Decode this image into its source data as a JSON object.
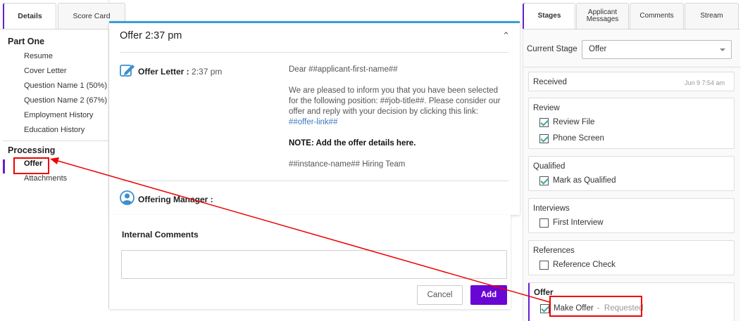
{
  "left_nav": {
    "tabs": [
      "Details",
      "Score Card"
    ],
    "sections": [
      {
        "title": "Part One",
        "items": [
          "Resume",
          "Cover Letter",
          "Question Name 1 (50%)",
          "Question Name 2 (67%)",
          "Employment History",
          "Education History"
        ]
      },
      {
        "title": "Processing",
        "items": [
          "Offer",
          "Attachments"
        ]
      }
    ],
    "active_item": "Offer"
  },
  "offer_card": {
    "title": "Offer 2:37 pm",
    "letter_label": "Offer Letter :",
    "letter_time": "2:37 pm",
    "body": {
      "greeting": "Dear ##applicant-first-name##",
      "paragraph": "We are pleased to inform you that you have been selected for the following position: ##job-title##. Please consider our offer and reply with your decision by clicking this link:",
      "link": "##offer-link##",
      "note": "NOTE: Add the offer details here.",
      "signature": "##instance-name## Hiring Team"
    },
    "manager_label": "Offering Manager :"
  },
  "comments": {
    "label": "Internal Comments",
    "value": "",
    "cancel_label": "Cancel",
    "add_label": "Add"
  },
  "right_panel": {
    "tabs": [
      "Stages",
      "Applicant Messages",
      "Comments",
      "Stream"
    ],
    "current_stage_label": "Current Stage",
    "current_stage_value": "Offer",
    "received": {
      "title": "Received",
      "date": "Jun 9 7:54 am"
    },
    "stages": [
      {
        "title": "Review",
        "items": [
          {
            "label": "Review File",
            "checked": true
          },
          {
            "label": "Phone Screen",
            "checked": true
          }
        ]
      },
      {
        "title": "Qualified",
        "items": [
          {
            "label": "Mark as Qualified",
            "checked": true
          }
        ]
      },
      {
        "title": "Interviews",
        "items": [
          {
            "label": "First Interview",
            "checked": false
          }
        ]
      },
      {
        "title": "References",
        "items": [
          {
            "label": "Reference Check",
            "checked": false
          }
        ]
      },
      {
        "title": "Offer",
        "items": [
          {
            "label": "Make Offer",
            "checked": true,
            "status": "Requested"
          }
        ]
      }
    ]
  },
  "colors": {
    "accent_purple": "#6a06d4",
    "accent_blue": "#3a9fd8",
    "annotation_red": "#e00000",
    "check_teal": "#3aa8a0"
  }
}
